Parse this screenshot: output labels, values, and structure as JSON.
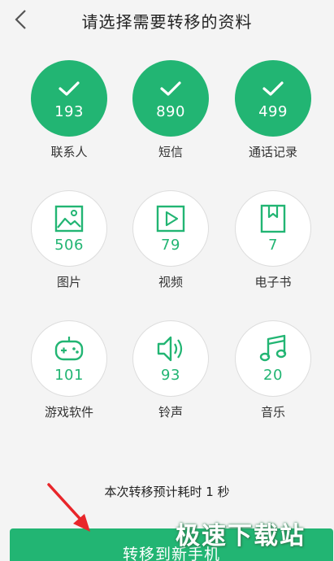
{
  "header": {
    "title": "请选择需要转移的资料"
  },
  "items": [
    {
      "label": "联系人",
      "count": "193",
      "selected": true
    },
    {
      "label": "短信",
      "count": "890",
      "selected": true
    },
    {
      "label": "通话记录",
      "count": "499",
      "selected": true
    },
    {
      "label": "图片",
      "count": "506",
      "selected": false,
      "icon": "image-icon"
    },
    {
      "label": "视频",
      "count": "79",
      "selected": false,
      "icon": "video-icon"
    },
    {
      "label": "电子书",
      "count": "7",
      "selected": false,
      "icon": "book-icon"
    },
    {
      "label": "游戏软件",
      "count": "101",
      "selected": false,
      "icon": "gamepad-icon"
    },
    {
      "label": "铃声",
      "count": "93",
      "selected": false,
      "icon": "speaker-icon"
    },
    {
      "label": "音乐",
      "count": "20",
      "selected": false,
      "icon": "music-note-icon"
    }
  ],
  "estimate_text": "本次转移预计耗时 1 秒",
  "transfer_button_label": "转移到新手机",
  "watermark": "极速下载站",
  "colors": {
    "accent": "#22b573",
    "background": "#f4f4f4",
    "annotation_arrow": "#e8262a"
  }
}
